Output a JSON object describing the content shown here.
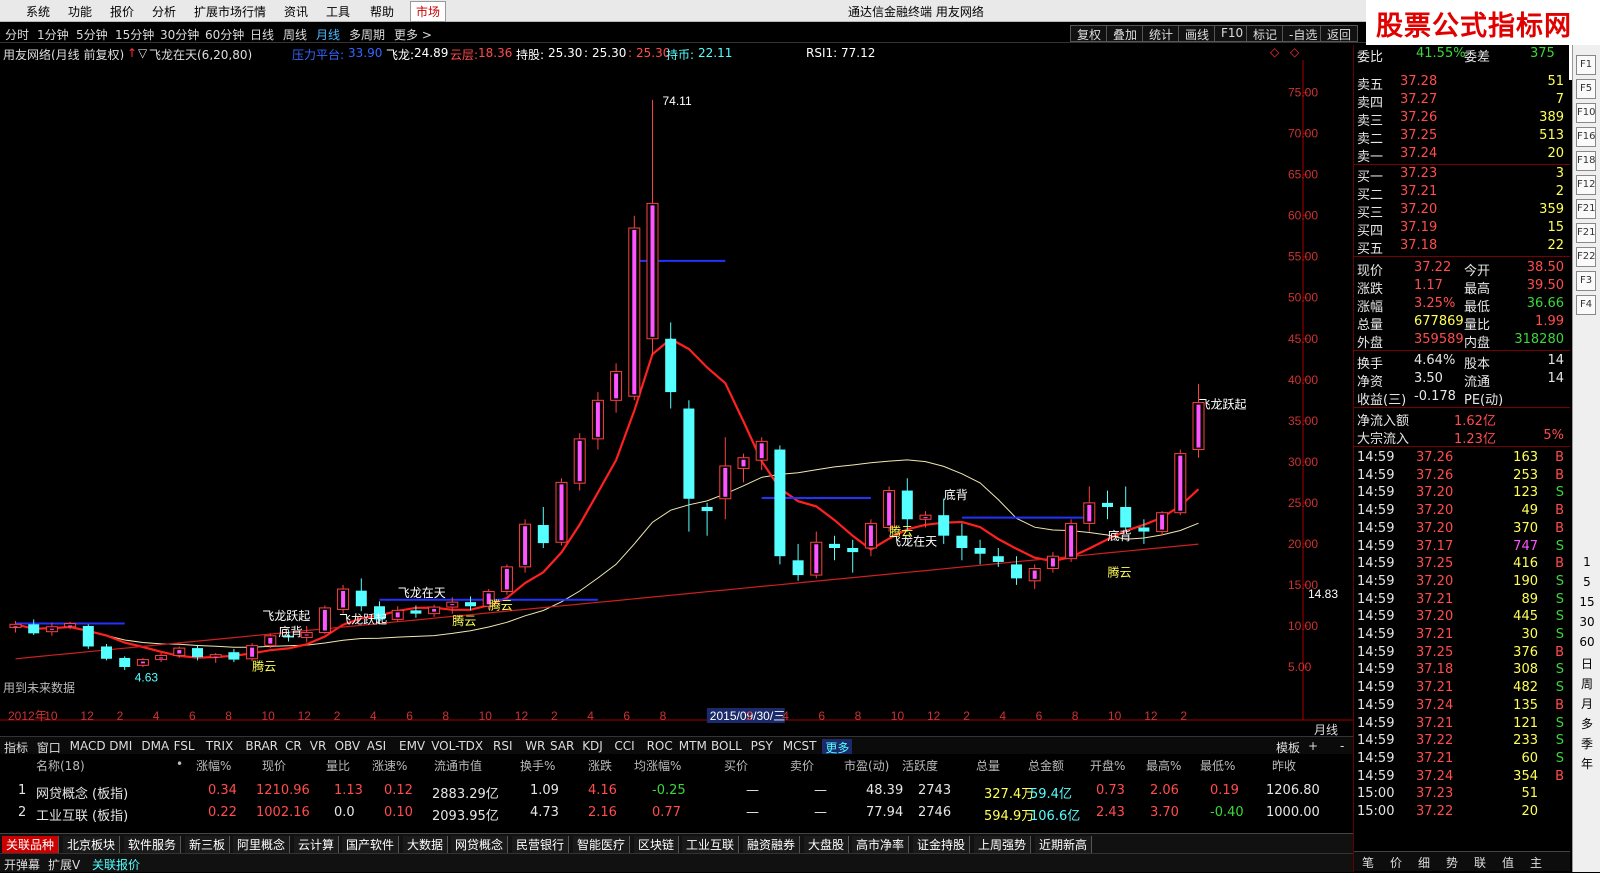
{
  "menu": {
    "items": [
      "系统",
      "功能",
      "报价",
      "分析",
      "扩展市场行情",
      "资讯",
      "工具",
      "帮助"
    ],
    "active_item": "市场",
    "app_title": "通达信金融终端  用友网络"
  },
  "logo": {
    "text_cn": "股票公式指标网",
    "url": "www.gszx.com.cn"
  },
  "periods": [
    "分时",
    "1分钟",
    "5分钟",
    "15分钟",
    "30分钟",
    "60分钟",
    "日线",
    "周线",
    "月线",
    "多周期",
    "更多 >"
  ],
  "active_period": "月线",
  "toolbar_buttons": [
    "复权",
    "叠加",
    "统计",
    "画线",
    "F10",
    "标记",
    "-自选",
    "返回"
  ],
  "indicator_line": {
    "stock": "用友网络(月线 前复权)",
    "formula": "飞龙在天(6,20,80)",
    "items": [
      {
        "label": "压力平台:",
        "value": "33.90"
      },
      {
        "label": "飞龙:",
        "value": "24.89"
      },
      {
        "label": "云层:",
        "value": "18.36"
      },
      {
        "label": "持股:",
        "value": "25.30"
      },
      {
        "label": ":",
        "value": "25.30"
      },
      {
        "label": ":",
        "value": "25.30"
      },
      {
        "label": "持币:",
        "value": "22.11"
      }
    ],
    "rsi": "RSI1: 77.12"
  },
  "chart_data": {
    "type": "candlestick",
    "title": "用友网络(月线 前复权)",
    "y_ticks": [
      "75.00",
      "70.00",
      "65.00",
      "60.00",
      "55.00",
      "50.00",
      "45.00",
      "40.00",
      "35.00",
      "30.00",
      "25.00",
      "20.00",
      "15.00",
      "10.00",
      "5.00"
    ],
    "ylim": [
      0,
      78
    ],
    "x_ticks": [
      "2012年",
      "10",
      "12",
      "2",
      "4",
      "6",
      "8",
      "10",
      "12",
      "2",
      "4",
      "6",
      "8",
      "10",
      "12",
      "2",
      "4",
      "6",
      "8",
      "2015/09/30/三",
      "2",
      "4",
      "6",
      "8",
      "10",
      "12",
      "2",
      "4",
      "6",
      "8",
      "10",
      "12",
      "2"
    ],
    "x_axis_label": "月线",
    "cursor_price": "14.83",
    "annotations": [
      "4.63",
      "74.11",
      "飞龙跃起",
      "飞龙在天",
      "腾云",
      "底背",
      "飞龙跃起",
      "腾云",
      "腾云",
      "底背",
      "飞龙在天",
      "腾云",
      "底背",
      "腾云",
      "腾云",
      "飞龙跃起",
      "用到未来数据"
    ],
    "candles": [
      {
        "o": 9.8,
        "h": 10.6,
        "l": 9.2,
        "c": 10.2
      },
      {
        "o": 10.2,
        "h": 10.8,
        "l": 8.9,
        "c": 9.1
      },
      {
        "o": 9.3,
        "h": 10.4,
        "l": 8.8,
        "c": 9.9
      },
      {
        "o": 9.9,
        "h": 10.5,
        "l": 9.6,
        "c": 10.3
      },
      {
        "o": 10.0,
        "h": 10.2,
        "l": 7.2,
        "c": 7.5
      },
      {
        "o": 7.5,
        "h": 7.8,
        "l": 5.8,
        "c": 6.0
      },
      {
        "o": 6.1,
        "h": 6.3,
        "l": 4.63,
        "c": 5.0
      },
      {
        "o": 5.2,
        "h": 6.1,
        "l": 5.0,
        "c": 5.9
      },
      {
        "o": 5.9,
        "h": 6.7,
        "l": 5.6,
        "c": 6.4
      },
      {
        "o": 6.4,
        "h": 7.5,
        "l": 6.1,
        "c": 7.3
      },
      {
        "o": 7.3,
        "h": 7.7,
        "l": 5.8,
        "c": 6.2
      },
      {
        "o": 6.2,
        "h": 6.7,
        "l": 5.5,
        "c": 6.5
      },
      {
        "o": 6.8,
        "h": 7.2,
        "l": 5.6,
        "c": 5.9
      },
      {
        "o": 6.0,
        "h": 7.9,
        "l": 5.7,
        "c": 7.6
      },
      {
        "o": 7.6,
        "h": 9.1,
        "l": 7.3,
        "c": 8.8
      },
      {
        "o": 8.8,
        "h": 9.5,
        "l": 8.1,
        "c": 8.6
      },
      {
        "o": 8.6,
        "h": 10.0,
        "l": 8.0,
        "c": 9.2
      },
      {
        "o": 9.2,
        "h": 12.5,
        "l": 9.0,
        "c": 12.2
      },
      {
        "o": 12.0,
        "h": 15.0,
        "l": 11.5,
        "c": 14.5
      },
      {
        "o": 14.3,
        "h": 15.8,
        "l": 11.8,
        "c": 12.4
      },
      {
        "o": 12.4,
        "h": 13.0,
        "l": 10.2,
        "c": 10.8
      },
      {
        "o": 10.8,
        "h": 12.4,
        "l": 10.5,
        "c": 11.9
      },
      {
        "o": 11.9,
        "h": 12.5,
        "l": 11.0,
        "c": 11.5
      },
      {
        "o": 11.5,
        "h": 12.6,
        "l": 11.1,
        "c": 12.3
      },
      {
        "o": 12.3,
        "h": 13.5,
        "l": 11.5,
        "c": 12.9
      },
      {
        "o": 12.9,
        "h": 13.6,
        "l": 11.9,
        "c": 12.4
      },
      {
        "o": 12.4,
        "h": 14.5,
        "l": 12.0,
        "c": 14.2
      },
      {
        "o": 14.2,
        "h": 17.5,
        "l": 13.8,
        "c": 17.2
      },
      {
        "o": 17.2,
        "h": 23.0,
        "l": 16.5,
        "c": 22.4
      },
      {
        "o": 22.3,
        "h": 24.5,
        "l": 19.5,
        "c": 20.1
      },
      {
        "o": 20.2,
        "h": 28.0,
        "l": 19.8,
        "c": 27.5
      },
      {
        "o": 27.4,
        "h": 33.5,
        "l": 26.5,
        "c": 32.8
      },
      {
        "o": 32.8,
        "h": 38.5,
        "l": 31.5,
        "c": 37.5
      },
      {
        "o": 37.5,
        "h": 42.0,
        "l": 36.0,
        "c": 41.0
      },
      {
        "o": 38.0,
        "h": 60.0,
        "l": 37.5,
        "c": 58.5
      },
      {
        "o": 45.0,
        "h": 74.11,
        "l": 43.0,
        "c": 61.5
      },
      {
        "o": 45.0,
        "h": 47.0,
        "l": 36.5,
        "c": 38.5
      },
      {
        "o": 36.5,
        "h": 37.5,
        "l": 21.5,
        "c": 25.5
      },
      {
        "o": 24.5,
        "h": 25.0,
        "l": 21.0,
        "c": 24.0
      },
      {
        "o": 25.5,
        "h": 33.0,
        "l": 23.0,
        "c": 29.5
      },
      {
        "o": 29.2,
        "h": 31.0,
        "l": 27.5,
        "c": 30.5
      },
      {
        "o": 30.2,
        "h": 33.0,
        "l": 29.0,
        "c": 32.5
      },
      {
        "o": 31.5,
        "h": 32.0,
        "l": 17.5,
        "c": 18.5
      },
      {
        "o": 18.0,
        "h": 20.0,
        "l": 15.5,
        "c": 16.2
      },
      {
        "o": 16.2,
        "h": 21.5,
        "l": 15.8,
        "c": 20.2
      },
      {
        "o": 20.0,
        "h": 21.0,
        "l": 18.0,
        "c": 19.5
      },
      {
        "o": 19.5,
        "h": 20.5,
        "l": 16.5,
        "c": 19.0
      },
      {
        "o": 19.5,
        "h": 23.0,
        "l": 18.5,
        "c": 22.5
      },
      {
        "o": 22.0,
        "h": 27.0,
        "l": 21.5,
        "c": 26.5
      },
      {
        "o": 26.5,
        "h": 28.0,
        "l": 21.5,
        "c": 23.0
      },
      {
        "o": 23.0,
        "h": 24.0,
        "l": 22.0,
        "c": 23.5
      },
      {
        "o": 23.5,
        "h": 25.5,
        "l": 20.0,
        "c": 21.0
      },
      {
        "o": 21.0,
        "h": 22.5,
        "l": 18.0,
        "c": 19.5
      },
      {
        "o": 19.5,
        "h": 20.5,
        "l": 17.5,
        "c": 18.8
      },
      {
        "o": 18.5,
        "h": 19.5,
        "l": 17.2,
        "c": 17.8
      },
      {
        "o": 17.5,
        "h": 18.5,
        "l": 15.0,
        "c": 15.8
      },
      {
        "o": 15.5,
        "h": 17.5,
        "l": 14.5,
        "c": 17.0
      },
      {
        "o": 17.0,
        "h": 19.0,
        "l": 16.5,
        "c": 18.5
      },
      {
        "o": 18.2,
        "h": 23.0,
        "l": 17.8,
        "c": 22.5
      },
      {
        "o": 22.5,
        "h": 27.0,
        "l": 21.5,
        "c": 25.0
      },
      {
        "o": 25.0,
        "h": 26.5,
        "l": 23.0,
        "c": 24.5
      },
      {
        "o": 24.5,
        "h": 27.0,
        "l": 21.5,
        "c": 22.0
      },
      {
        "o": 22.0,
        "h": 23.0,
        "l": 20.0,
        "c": 21.5
      },
      {
        "o": 21.5,
        "h": 24.0,
        "l": 21.0,
        "c": 23.8
      },
      {
        "o": 23.8,
        "h": 31.5,
        "l": 23.5,
        "c": 31.0
      },
      {
        "o": 31.5,
        "h": 39.5,
        "l": 30.5,
        "c": 37.22
      }
    ]
  },
  "order_book": {
    "header_left": "委比",
    "header_left_val": "41.55%",
    "header_right": "委差",
    "header_right_val": "375",
    "sells": [
      {
        "label": "卖五",
        "price": "37.28",
        "vol": "51"
      },
      {
        "label": "卖四",
        "price": "37.27",
        "vol": "7"
      },
      {
        "label": "卖三",
        "price": "37.26",
        "vol": "389"
      },
      {
        "label": "卖二",
        "price": "37.25",
        "vol": "513"
      },
      {
        "label": "卖一",
        "price": "37.24",
        "vol": "20"
      }
    ],
    "buys": [
      {
        "label": "买一",
        "price": "37.23",
        "vol": "3"
      },
      {
        "label": "买二",
        "price": "37.21",
        "vol": "2"
      },
      {
        "label": "买三",
        "price": "37.20",
        "vol": "359"
      },
      {
        "label": "买四",
        "price": "37.19",
        "vol": "15"
      },
      {
        "label": "买五",
        "price": "37.18",
        "vol": "22"
      }
    ]
  },
  "quote": [
    {
      "l1": "现价",
      "v1": "37.22",
      "l2": "今开",
      "v2": "38.50"
    },
    {
      "l1": "涨跌",
      "v1": "1.17",
      "l2": "最高",
      "v2": "39.50"
    },
    {
      "l1": "涨幅",
      "v1": "3.25%",
      "l2": "最低",
      "v2": "36.66"
    },
    {
      "l1": "总量",
      "v1": "677869",
      "l2": "量比",
      "v2": "1.99"
    },
    {
      "l1": "外盘",
      "v1": "359589",
      "l2": "内盘",
      "v2": "318280"
    },
    {
      "l1": "换手",
      "v1": "4.64%",
      "l2": "股本",
      "v2": "14"
    },
    {
      "l1": "净资",
      "v1": "3.50",
      "l2": "流通",
      "v2": "14"
    },
    {
      "l1": "收益(三)",
      "v1": "-0.178",
      "l2": "PE(动)",
      "v2": ""
    }
  ],
  "flows": [
    {
      "label": "净流入额",
      "value": "1.62亿",
      "pct": ""
    },
    {
      "label": "大宗流入",
      "value": "1.23亿",
      "pct": "5%"
    }
  ],
  "ticks": [
    {
      "t": "14:59",
      "p": "37.26",
      "v": "163",
      "d": "B"
    },
    {
      "t": "14:59",
      "p": "37.26",
      "v": "253",
      "d": "B"
    },
    {
      "t": "14:59",
      "p": "37.20",
      "v": "123",
      "d": "S"
    },
    {
      "t": "14:59",
      "p": "37.20",
      "v": "49",
      "d": "B"
    },
    {
      "t": "14:59",
      "p": "37.20",
      "v": "370",
      "d": "B"
    },
    {
      "t": "14:59",
      "p": "37.17",
      "v": "747",
      "d": "S"
    },
    {
      "t": "14:59",
      "p": "37.25",
      "v": "416",
      "d": "B"
    },
    {
      "t": "14:59",
      "p": "37.20",
      "v": "190",
      "d": "S"
    },
    {
      "t": "14:59",
      "p": "37.21",
      "v": "89",
      "d": "S"
    },
    {
      "t": "14:59",
      "p": "37.20",
      "v": "445",
      "d": "S"
    },
    {
      "t": "14:59",
      "p": "37.21",
      "v": "30",
      "d": "S"
    },
    {
      "t": "14:59",
      "p": "37.25",
      "v": "376",
      "d": "B"
    },
    {
      "t": "14:59",
      "p": "37.18",
      "v": "308",
      "d": "S"
    },
    {
      "t": "14:59",
      "p": "37.21",
      "v": "482",
      "d": "S"
    },
    {
      "t": "14:59",
      "p": "37.24",
      "v": "135",
      "d": "B"
    },
    {
      "t": "14:59",
      "p": "37.21",
      "v": "121",
      "d": "S"
    },
    {
      "t": "14:59",
      "p": "37.22",
      "v": "233",
      "d": "S"
    },
    {
      "t": "14:59",
      "p": "37.21",
      "v": "60",
      "d": "S"
    },
    {
      "t": "14:59",
      "p": "37.24",
      "v": "354",
      "d": "B"
    },
    {
      "t": "15:00",
      "p": "37.23",
      "v": "51",
      "d": ""
    },
    {
      "t": "15:00",
      "p": "37.22",
      "v": "20",
      "d": ""
    }
  ],
  "right_bottom_tabs": [
    "笔",
    "价",
    "细",
    "势",
    "联",
    "值",
    "主"
  ],
  "right_strip_labels": [
    "1",
    "5",
    "15",
    "30",
    "60",
    "日",
    "周",
    "月",
    "多",
    "季",
    "年"
  ],
  "right_strip_icons": [
    "F1",
    "F5",
    "F10",
    "F16",
    "F18",
    "F12",
    "F21",
    "F21",
    "F22",
    "F3",
    "F4"
  ],
  "indicator_tabs": [
    "指标",
    "窗口",
    "MACD",
    "DMI",
    "DMA",
    "FSL",
    "TRIX",
    "BRAR",
    "CR",
    "VR",
    "OBV",
    "ASI",
    "EMV",
    "VOL-TDX",
    "RSI",
    "WR",
    "SAR",
    "KDJ",
    "CCI",
    "ROC",
    "MTM",
    "BOLL",
    "PSY",
    "MCST",
    "更多"
  ],
  "indicator_tabs_right": [
    "模板",
    "+",
    "-"
  ],
  "table": {
    "headers": [
      "名称(18)",
      "•",
      "涨幅%",
      "现价",
      "量比",
      "涨速%",
      "流通市值",
      "换手%",
      "涨跌",
      "均涨幅%",
      "买价",
      "卖价",
      "市盈(动)",
      "活跃度",
      "总量",
      "总金额",
      "开盘%",
      "最高%",
      "最低%",
      "昨收"
    ],
    "rows": [
      [
        "1",
        "网贷概念",
        "(板指)",
        "0.34",
        "1210.96",
        "1.13",
        "0.12",
        "2883.29亿",
        "1.09",
        "4.16",
        "-0.25",
        "—",
        "—",
        "48.39",
        "2743",
        "327.4万",
        "59.4亿",
        "0.73",
        "2.06",
        "0.19",
        "1206.80"
      ],
      [
        "2",
        "工业互联",
        "(板指)",
        "0.22",
        "1002.16",
        "0.0",
        "0.10",
        "2093.95亿",
        "4.73",
        "2.16",
        "0.77",
        "—",
        "—",
        "77.94",
        "2746",
        "594.9万",
        "106.6亿",
        "2.43",
        "3.70",
        "-0.40",
        "1000.00"
      ]
    ]
  },
  "sector_tabs": [
    "关联品种",
    "北京板块",
    "软件服务",
    "新三板",
    "阿里概念",
    "云计算",
    "国产软件",
    "大数据",
    "网贷概念",
    "民营银行",
    "智能医疗",
    "区块链",
    "工业互联",
    "融资融券",
    "大盘股",
    "高市净率",
    "证金持股",
    "上周强势",
    "近期新高"
  ],
  "status_bar": [
    "开弹幕",
    "扩展V",
    "关联报价"
  ]
}
